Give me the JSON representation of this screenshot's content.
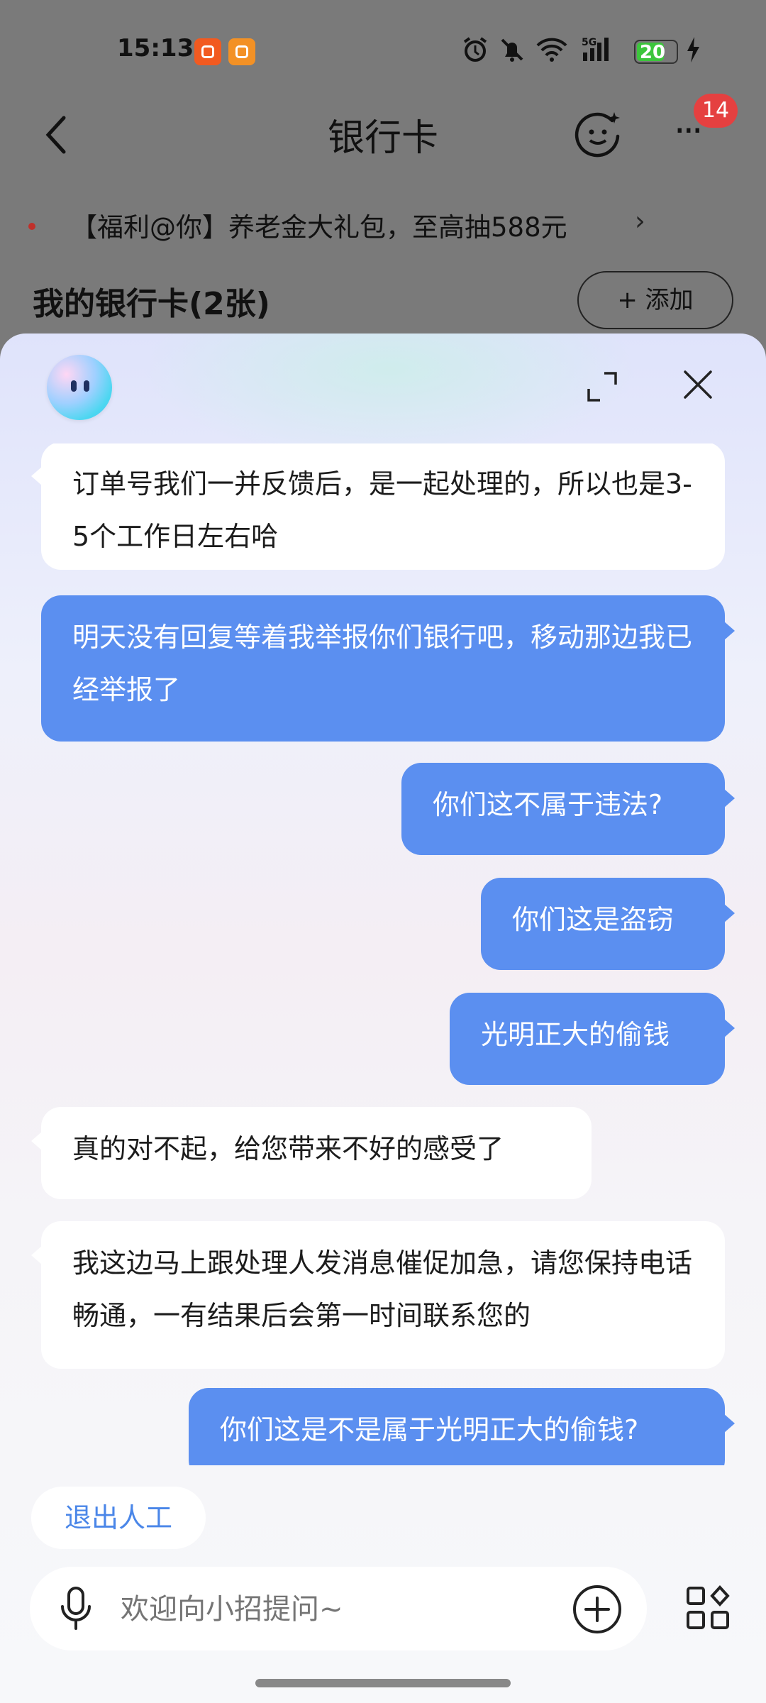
{
  "status_bar": {
    "time": "15:13",
    "battery": "20",
    "network": "5G"
  },
  "header": {
    "title": "银行卡",
    "notification_count": "14"
  },
  "promo": {
    "text": "【福利@你】养老金大礼包，至高抽588元",
    "chevron": "›"
  },
  "cards": {
    "heading": "我的银行卡(2张)",
    "add_label": "+ 添加"
  },
  "chat": {
    "messages": [
      {
        "role": "bot",
        "text": "订单号我们一并反馈后，是一起处理的，所以也是3-5个工作日左右哈"
      },
      {
        "role": "user",
        "text": "明天没有回复等着我举报你们银行吧，移动那边我已经举报了"
      },
      {
        "role": "user",
        "text": "你们这不属于违法?"
      },
      {
        "role": "user",
        "text": "你们这是盗窃"
      },
      {
        "role": "user",
        "text": "光明正大的偷钱"
      },
      {
        "role": "bot",
        "text": "真的对不起，给您带来不好的感受了"
      },
      {
        "role": "bot",
        "text": "我这边马上跟处理人发消息催促加急，请您保持电话畅通，一有结果后会第一时间联系您的"
      },
      {
        "role": "user",
        "text": "你们这是不是属于光明正大的偷钱?"
      }
    ],
    "exit_manual_label": "退出人工",
    "input_placeholder": "欢迎向小招提问~"
  },
  "icons": [
    "back-icon",
    "smile-ai-icon",
    "more-icon",
    "expand-icon",
    "close-icon",
    "mic-icon",
    "plus-icon",
    "grid-icon"
  ],
  "colors": {
    "user_bubble": "#5b8ff0",
    "link_blue": "#4a86e8",
    "badge_red": "#e54040"
  }
}
